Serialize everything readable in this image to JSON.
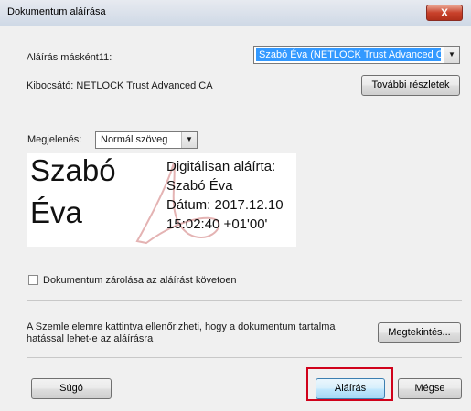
{
  "window": {
    "title": "Dokumentum aláírása",
    "close_label": "X"
  },
  "signer": {
    "label": "Aláírás másként11:",
    "value": "Szabó Éva (NETLOCK Trust Advanced CA) ."
  },
  "issuer": {
    "label": "Kibocsátó: NETLOCK Trust Advanced CA",
    "details_button": "További részletek"
  },
  "appearance": {
    "label": "Megjelenés:",
    "value": "Normál szöveg"
  },
  "preview": {
    "name_line1": "Szabó",
    "name_line2": "Éva",
    "info_line1": "Digitálisan aláírta:",
    "info_line2": "Szabó Éva",
    "info_line3": "Dátum: 2017.12.10",
    "info_line4": "15:02:40 +01'00'"
  },
  "lock": {
    "label": "Dokumentum zárolása az aláírást követoen"
  },
  "review": {
    "text_line1": "A Szemle elemre kattintva ellenőrizheti, hogy a dokumentum tartalma",
    "text_line2": "hatással lehet-e az aláírásra",
    "button": "Megtekintés..."
  },
  "footer": {
    "help_button": "Súgó",
    "sign_button": "Aláírás",
    "cancel_button": "Mégse"
  },
  "colors": {
    "highlight": "#d0021b",
    "selection": "#3399ff",
    "watermark": "#e4b3b3"
  }
}
